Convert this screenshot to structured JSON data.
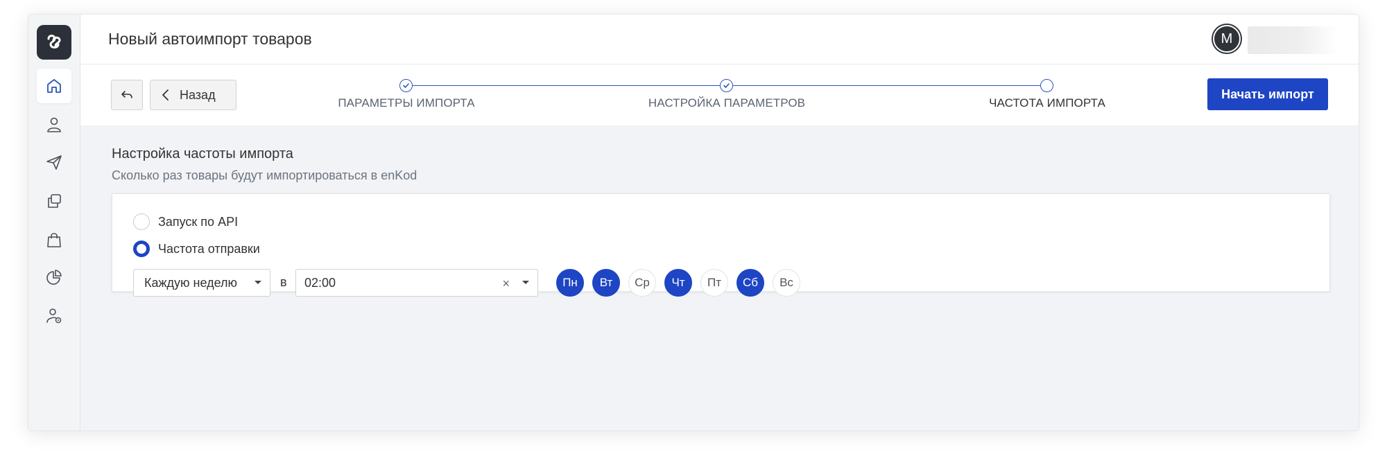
{
  "header": {
    "title": "Новый автоимпорт товаров",
    "avatar_letter": "M"
  },
  "sidebar": {
    "items": [
      {
        "name": "home",
        "icon": "home-icon",
        "active": true
      },
      {
        "name": "contacts",
        "icon": "person-icon",
        "active": false
      },
      {
        "name": "campaigns",
        "icon": "paper-plane-icon",
        "active": false
      },
      {
        "name": "templates",
        "icon": "copy-icon",
        "active": false
      },
      {
        "name": "products",
        "icon": "shopping-bag-icon",
        "active": false
      },
      {
        "name": "analytics",
        "icon": "pie-chart-icon",
        "active": false
      },
      {
        "name": "account-settings",
        "icon": "user-gear-icon",
        "active": false
      }
    ]
  },
  "toolbar": {
    "back_label": "Назад",
    "start_label": "Начать импорт"
  },
  "stepper": {
    "steps": [
      {
        "label": "ПАРАМЕТРЫ ИМПОРТА",
        "state": "done"
      },
      {
        "label": "НАСТРОЙКА ПАРАМЕТРОВ",
        "state": "done"
      },
      {
        "label": "ЧАСТОТА ИМПОРТА",
        "state": "current"
      }
    ]
  },
  "section": {
    "title": "Настройка частоты импорта",
    "subtitle": "Сколько раз товары будут импортироваться в enKod"
  },
  "frequency": {
    "options": [
      {
        "label": "Запуск по API",
        "checked": false
      },
      {
        "label": "Частота отправки",
        "checked": true
      }
    ],
    "period_value": "Каждую неделю",
    "at_label": "в",
    "time_value": "02:00",
    "clear_symbol": "×",
    "days": [
      {
        "label": "Пн",
        "selected": true
      },
      {
        "label": "Вт",
        "selected": true
      },
      {
        "label": "Ср",
        "selected": false
      },
      {
        "label": "Чт",
        "selected": true
      },
      {
        "label": "Пт",
        "selected": false
      },
      {
        "label": "Сб",
        "selected": true
      },
      {
        "label": "Вс",
        "selected": false
      }
    ]
  },
  "colors": {
    "accent": "#1d45c4",
    "stepper_line": "#2b55b8",
    "sidebar_bg": "#f3f4f6",
    "content_bg": "#f2f3f6",
    "logo_bg": "#2c3038"
  }
}
